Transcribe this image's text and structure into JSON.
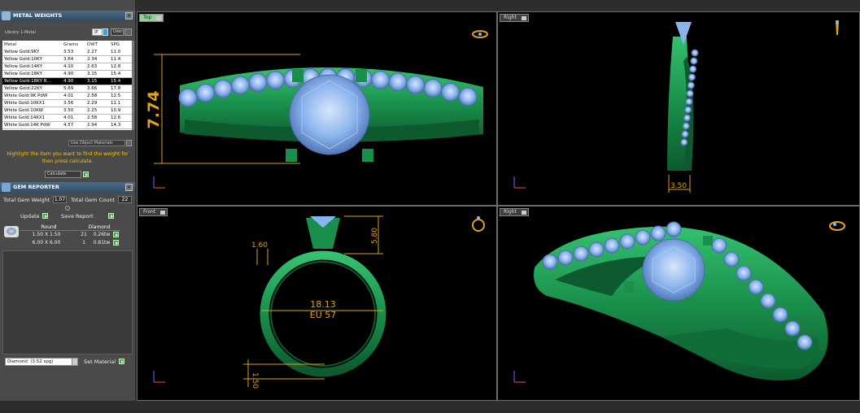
{
  "metal_weights": {
    "title": "METAL WEIGHTS",
    "library_label": "Library",
    "library_value": "1-Metal",
    "unit_value": "gr",
    "user_label": "User",
    "columns": [
      "Metal",
      "Grams",
      "DWT",
      "SPG"
    ],
    "rows": [
      [
        "Yellow Gold:9KY",
        "3.53",
        "2.27",
        "11.0"
      ],
      [
        "Yellow Gold:10KY",
        "3.64",
        "2.34",
        "11.4"
      ],
      [
        "Yellow Gold:14KY",
        "4.10",
        "2.63",
        "12.8"
      ],
      [
        "Yellow Gold:18KY",
        "4.90",
        "3.15",
        "15.4"
      ],
      [
        "Yellow Gold:18KY R...",
        "4.90",
        "3.15",
        "15.4"
      ],
      [
        "Yellow Gold:22KY",
        "5.69",
        "3.66",
        "17.8"
      ],
      [
        "White Gold:9K PdW",
        "4.01",
        "2.58",
        "12.5"
      ],
      [
        "White Gold:10KX1",
        "3.56",
        "2.29",
        "11.1"
      ],
      [
        "White Gold:10KW",
        "3.50",
        "2.25",
        "10.9"
      ],
      [
        "White Gold:14KX1",
        "4.01",
        "2.58",
        "12.6"
      ],
      [
        "White Gold:14K PdW",
        "4.57",
        "2.94",
        "14.3"
      ]
    ],
    "selected_row": 4,
    "use_object_materials": "Use Object Materials",
    "hint": "Highlight the item you want to find the weight for then press calculate.",
    "calculate": "Calculate"
  },
  "gem_reporter": {
    "title": "GEM REPORTER",
    "total_weight_label": "Total Gem Weight",
    "total_weight_value": "1.07",
    "total_count_label": "Total Gem Count",
    "total_count_value": "22",
    "update_label": "Update",
    "save_report_label": "Save Report",
    "shape_label": "Round",
    "type_label": "Diamond",
    "gems": [
      {
        "size": "1.50 X 1.50",
        "count": "21",
        "weight": "0.26tw"
      },
      {
        "size": "6.00 X 6.00",
        "count": "1",
        "weight": "0.81tw"
      }
    ],
    "material_select": "Diamond",
    "material_spg": "(3.52 spg)",
    "set_material_label": "Set Material"
  },
  "viewports": {
    "top_left": {
      "label": "Top",
      "dimension": "7.74"
    },
    "top_right": {
      "label": "Right",
      "dimension": "3.50"
    },
    "bottom_left": {
      "label": "Front",
      "dim_inner": "18.13",
      "dim_size": "EU 57",
      "dim_prong": "1.60",
      "dim_height": "5.80",
      "dim_band": "1.50"
    },
    "bottom_right": {
      "label": "Right"
    }
  },
  "colors": {
    "metal": "#1f9e57",
    "metal_dark": "#0c5a2e",
    "gem": "#8ab4ee",
    "dimension": "#e0a216",
    "viewport_bg": "#000000"
  }
}
